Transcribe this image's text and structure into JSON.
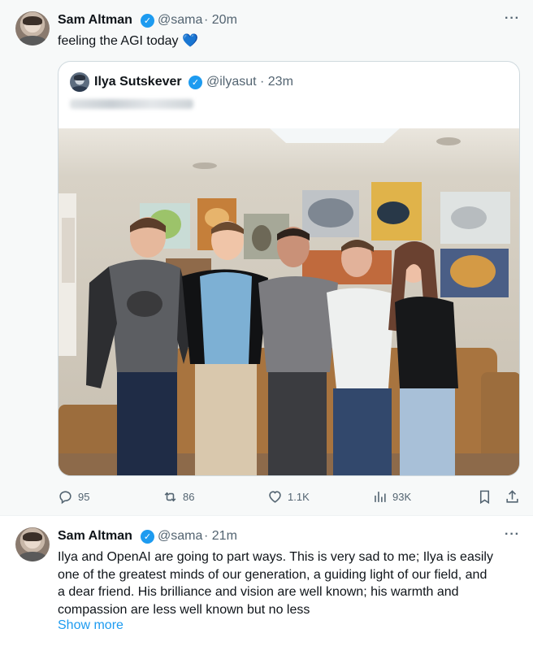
{
  "tweet1": {
    "author_name": "Sam Altman",
    "handle": "@sama",
    "time": "· 20m",
    "text": "feeling the AGI today 💙",
    "more": "···",
    "quote": {
      "author_name": "Ilya Sutskever",
      "handle": "@ilyasut",
      "time": "· 23m"
    },
    "stats": {
      "replies": "95",
      "reposts": "86",
      "likes": "1.1K",
      "views": "93K"
    }
  },
  "tweet2": {
    "author_name": "Sam Altman",
    "handle": "@sama",
    "time": "· 21m",
    "more": "···",
    "lines": [
      "Ilya and OpenAI are going to part ways. This is very sad to me; Ilya is easily",
      "one of the greatest minds of our generation, a guiding light of our field, and",
      "a dear friend. His brilliance and vision are well known; his warmth and",
      "compassion are less well known but no less"
    ],
    "show_more": "Show more"
  },
  "colors": {
    "accent": "#1d9bf0",
    "secondary_text": "#536471",
    "tweet_bg": "#f7f9f9"
  },
  "icons": [
    "verified-badge-icon",
    "reply-icon",
    "repost-icon",
    "like-icon",
    "views-icon",
    "bookmark-icon",
    "share-icon",
    "more-icon"
  ]
}
